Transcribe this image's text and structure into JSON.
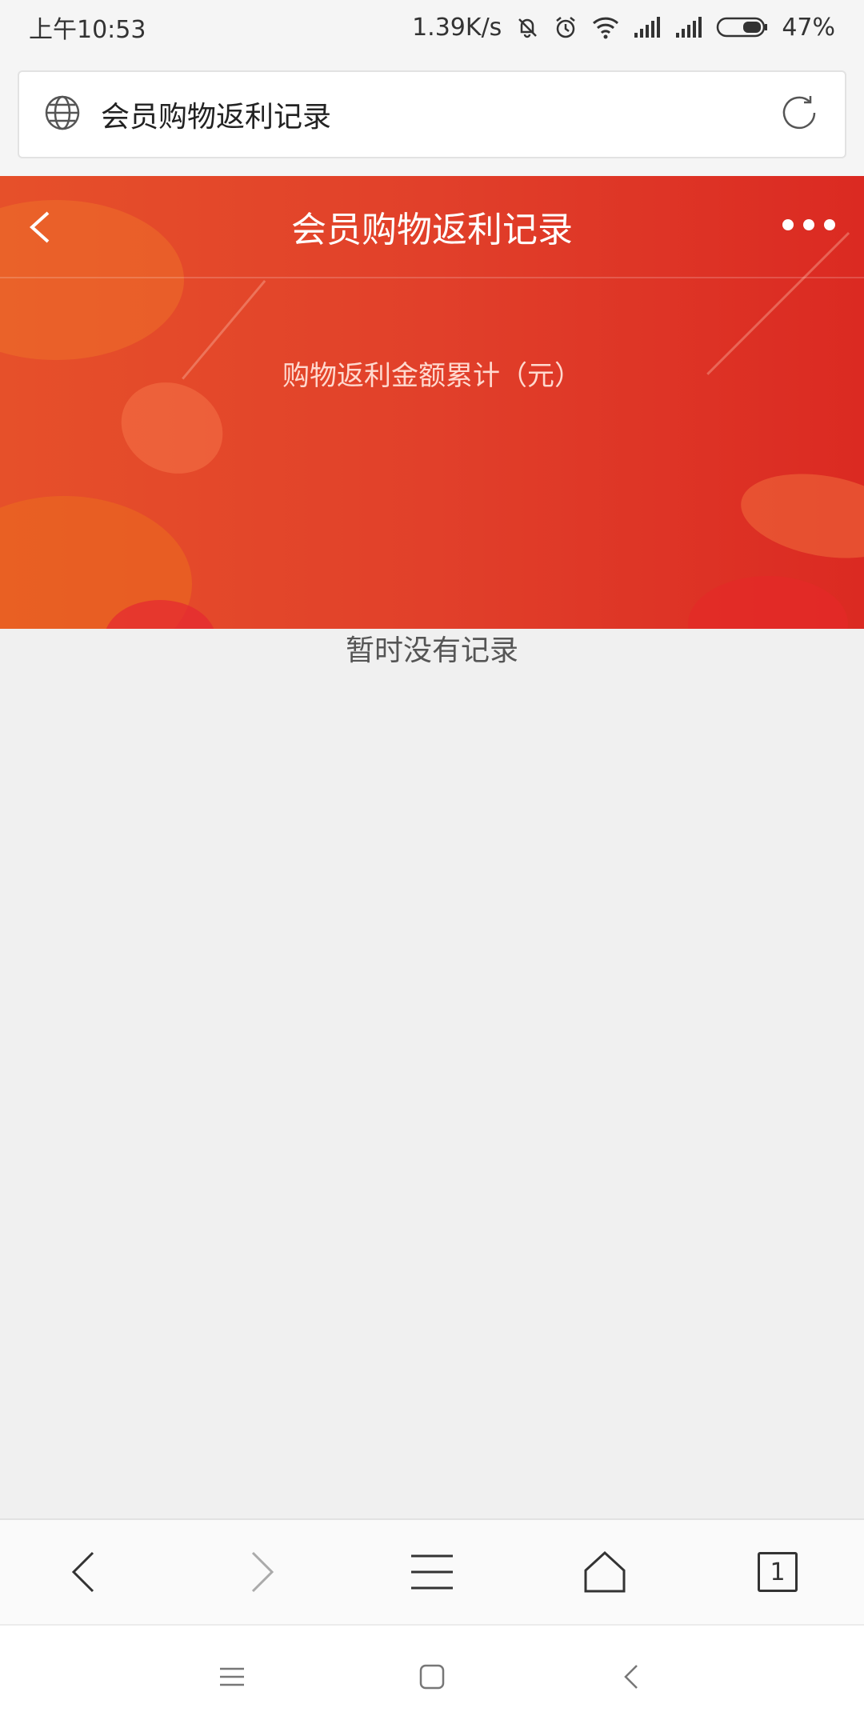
{
  "status_bar": {
    "time": "上午10:53",
    "network_speed": "1.39K/s",
    "battery": "47%",
    "icons": [
      "mute-icon",
      "alarm-icon",
      "wifi-icon",
      "signal-icon",
      "signal-icon",
      "battery-icon"
    ]
  },
  "address_bar": {
    "page_title": "会员购物返利记录",
    "icons": [
      "globe-icon",
      "reload-icon"
    ]
  },
  "header": {
    "title": "会员购物返利记录",
    "summary_label": "购物返利金额累计（元）",
    "accent_color": "#e1402a"
  },
  "main": {
    "empty_text": "暂时没有记录"
  },
  "toolbar": {
    "tab_count": "1",
    "icons": [
      "back-icon",
      "forward-icon",
      "menu-icon",
      "home-icon",
      "tabs-icon"
    ]
  },
  "system_nav": {
    "icons": [
      "recents-icon",
      "home-icon",
      "back-icon"
    ]
  }
}
